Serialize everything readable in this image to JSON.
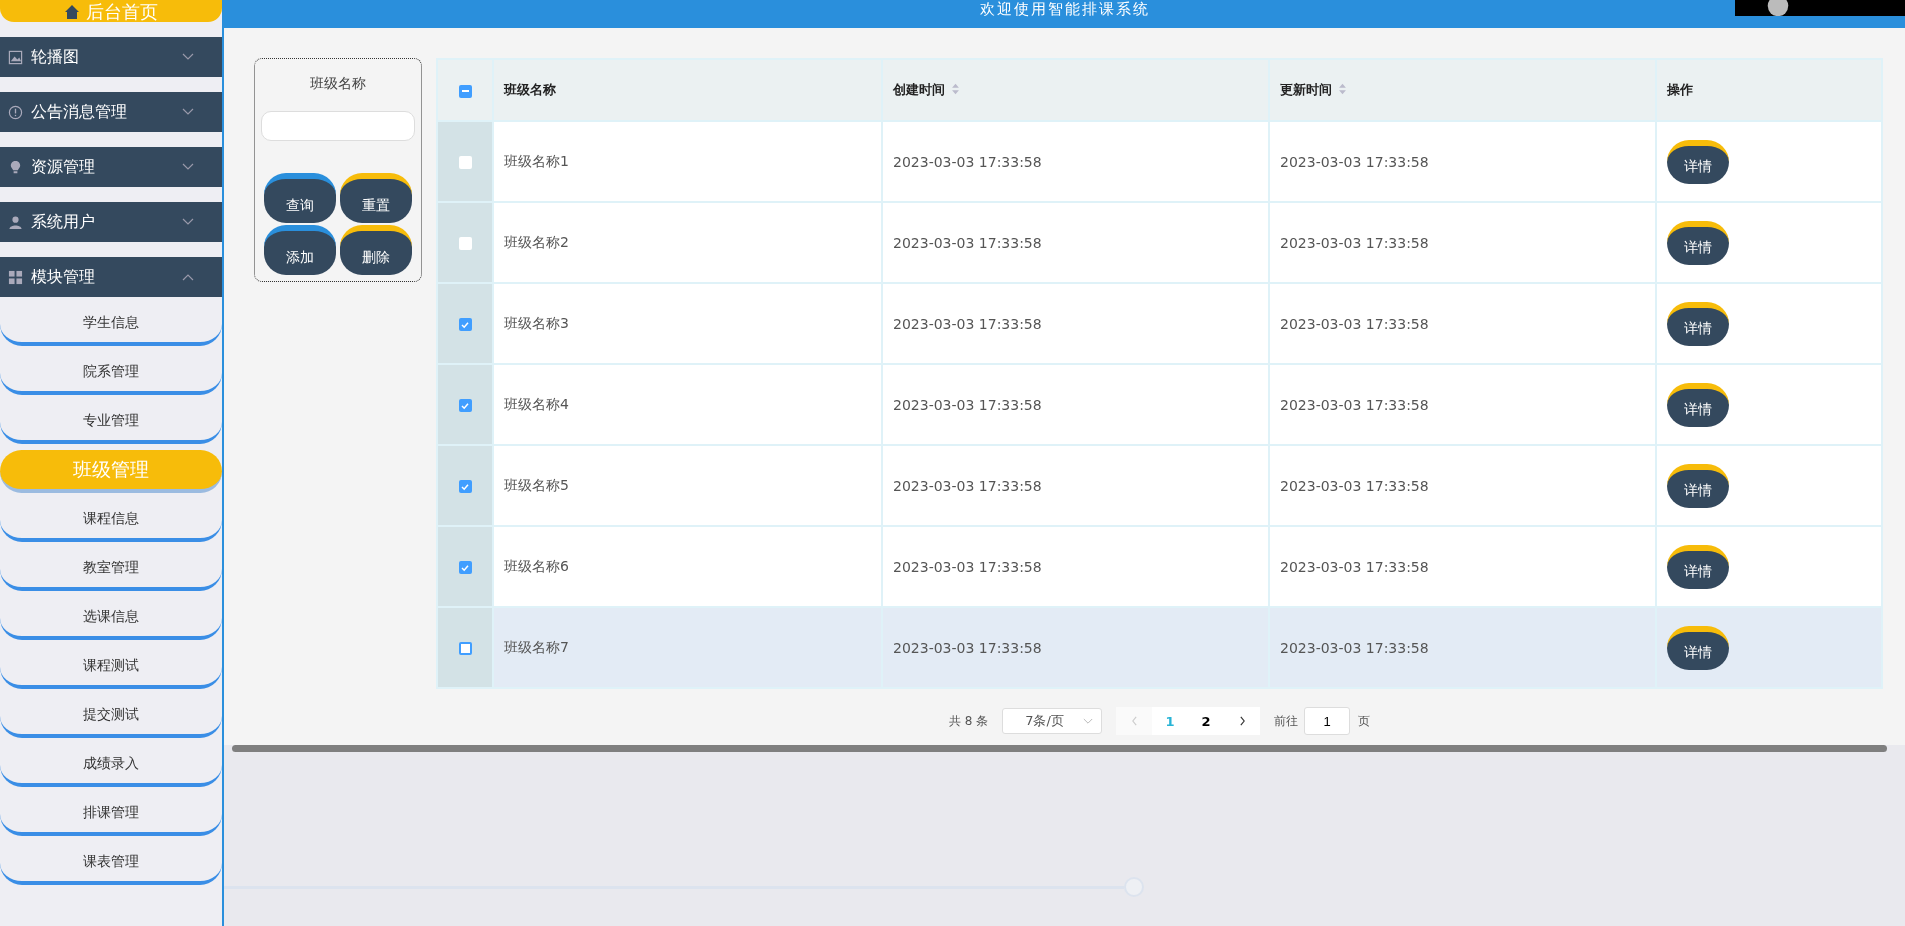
{
  "sidebar": {
    "home": {
      "label": "后台首页"
    },
    "groups": [
      {
        "label": "轮播图",
        "expanded": false
      },
      {
        "label": "公告消息管理",
        "expanded": false
      },
      {
        "label": "资源管理",
        "expanded": false
      },
      {
        "label": "系统用户",
        "expanded": false
      },
      {
        "label": "模块管理",
        "expanded": true,
        "children": [
          {
            "label": "学生信息",
            "selected": false
          },
          {
            "label": "院系管理",
            "selected": false
          },
          {
            "label": "专业管理",
            "selected": false
          },
          {
            "label": "班级管理",
            "selected": true
          },
          {
            "label": "课程信息",
            "selected": false
          },
          {
            "label": "教室管理",
            "selected": false
          },
          {
            "label": "选课信息",
            "selected": false
          },
          {
            "label": "课程测试",
            "selected": false
          },
          {
            "label": "提交测试",
            "selected": false
          },
          {
            "label": "成绩录入",
            "selected": false
          },
          {
            "label": "排课管理",
            "selected": false
          },
          {
            "label": "课表管理",
            "selected": false
          }
        ]
      }
    ]
  },
  "header": {
    "title": "欢迎使用智能排课系统"
  },
  "search": {
    "label": "班级名称",
    "buttons": [
      {
        "label": "查询",
        "kind": "blue"
      },
      {
        "label": "重置",
        "kind": "yellow"
      },
      {
        "label": "添加",
        "kind": "blue"
      },
      {
        "label": "删除",
        "kind": "yellow"
      }
    ]
  },
  "table": {
    "indeterminate": true,
    "columns": [
      {
        "label": "班级名称",
        "sortable": false
      },
      {
        "label": "创建时间",
        "sortable": true
      },
      {
        "label": "更新时间",
        "sortable": true
      },
      {
        "label": "操作",
        "sortable": false
      }
    ],
    "rows": [
      {
        "checked": false,
        "hovered": false,
        "name": "班级名称1",
        "created": "2023-03-03 17:33:58",
        "updated": "2023-03-03 17:33:58",
        "action": "详情"
      },
      {
        "checked": false,
        "hovered": false,
        "name": "班级名称2",
        "created": "2023-03-03 17:33:58",
        "updated": "2023-03-03 17:33:58",
        "action": "详情"
      },
      {
        "checked": true,
        "hovered": false,
        "name": "班级名称3",
        "created": "2023-03-03 17:33:58",
        "updated": "2023-03-03 17:33:58",
        "action": "详情"
      },
      {
        "checked": true,
        "hovered": false,
        "name": "班级名称4",
        "created": "2023-03-03 17:33:58",
        "updated": "2023-03-03 17:33:58",
        "action": "详情"
      },
      {
        "checked": true,
        "hovered": false,
        "name": "班级名称5",
        "created": "2023-03-03 17:33:58",
        "updated": "2023-03-03 17:33:58",
        "action": "详情"
      },
      {
        "checked": true,
        "hovered": false,
        "name": "班级名称6",
        "created": "2023-03-03 17:33:58",
        "updated": "2023-03-03 17:33:58",
        "action": "详情"
      },
      {
        "checked": false,
        "hovered": true,
        "name": "班级名称7",
        "created": "2023-03-03 17:33:58",
        "updated": "2023-03-03 17:33:58",
        "action": "详情"
      }
    ]
  },
  "pagination": {
    "total": "共 8 条",
    "page_size": "7条/页",
    "prev_disabled": true,
    "pages": [
      {
        "label": "1",
        "selected": true
      },
      {
        "label": "2",
        "selected": false
      }
    ],
    "goto_label": "前往",
    "goto_value": "1",
    "goto_suffix": "页"
  }
}
